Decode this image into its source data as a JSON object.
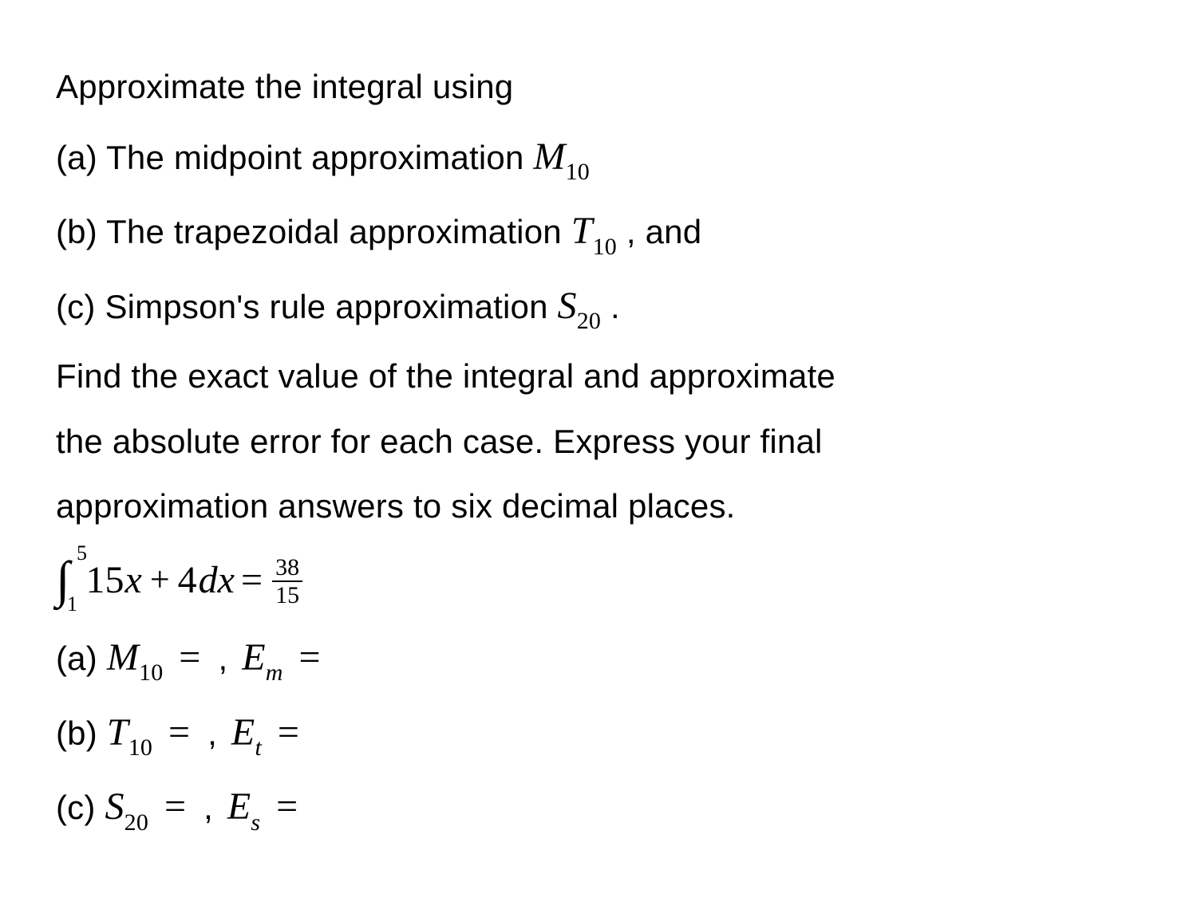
{
  "intro": "Approximate the integral using",
  "part_a_label": "(a) The midpoint approximation ",
  "part_b_label": "(b) The trapezoidal approximation ",
  "part_b_tail": " , and",
  "part_c_label": "(c) Simpson's rule approximation ",
  "part_c_tail": " .",
  "sym_M": "M",
  "sym_T": "T",
  "sym_S": "S",
  "sym_E": "E",
  "sub_10": "10",
  "sub_20": "20",
  "sub_m": "m",
  "sub_t": "t",
  "sub_s": "s",
  "instr_1": "Find the exact value of the integral and approximate",
  "instr_2": "the absolute error for each case. Express your final",
  "instr_3": "approximation answers to six decimal places.",
  "integral": {
    "lower": "1",
    "upper": "5",
    "coef": "15",
    "var": "x",
    "plus": "+",
    "const": "4",
    "dvar": "dx",
    "eq": "=",
    "frac_num": "38",
    "frac_den": "15"
  },
  "ans_a_prefix": "(a) ",
  "ans_b_prefix": "(b) ",
  "ans_c_prefix": "(c) ",
  "comma": " , ",
  "eq_sym": "="
}
